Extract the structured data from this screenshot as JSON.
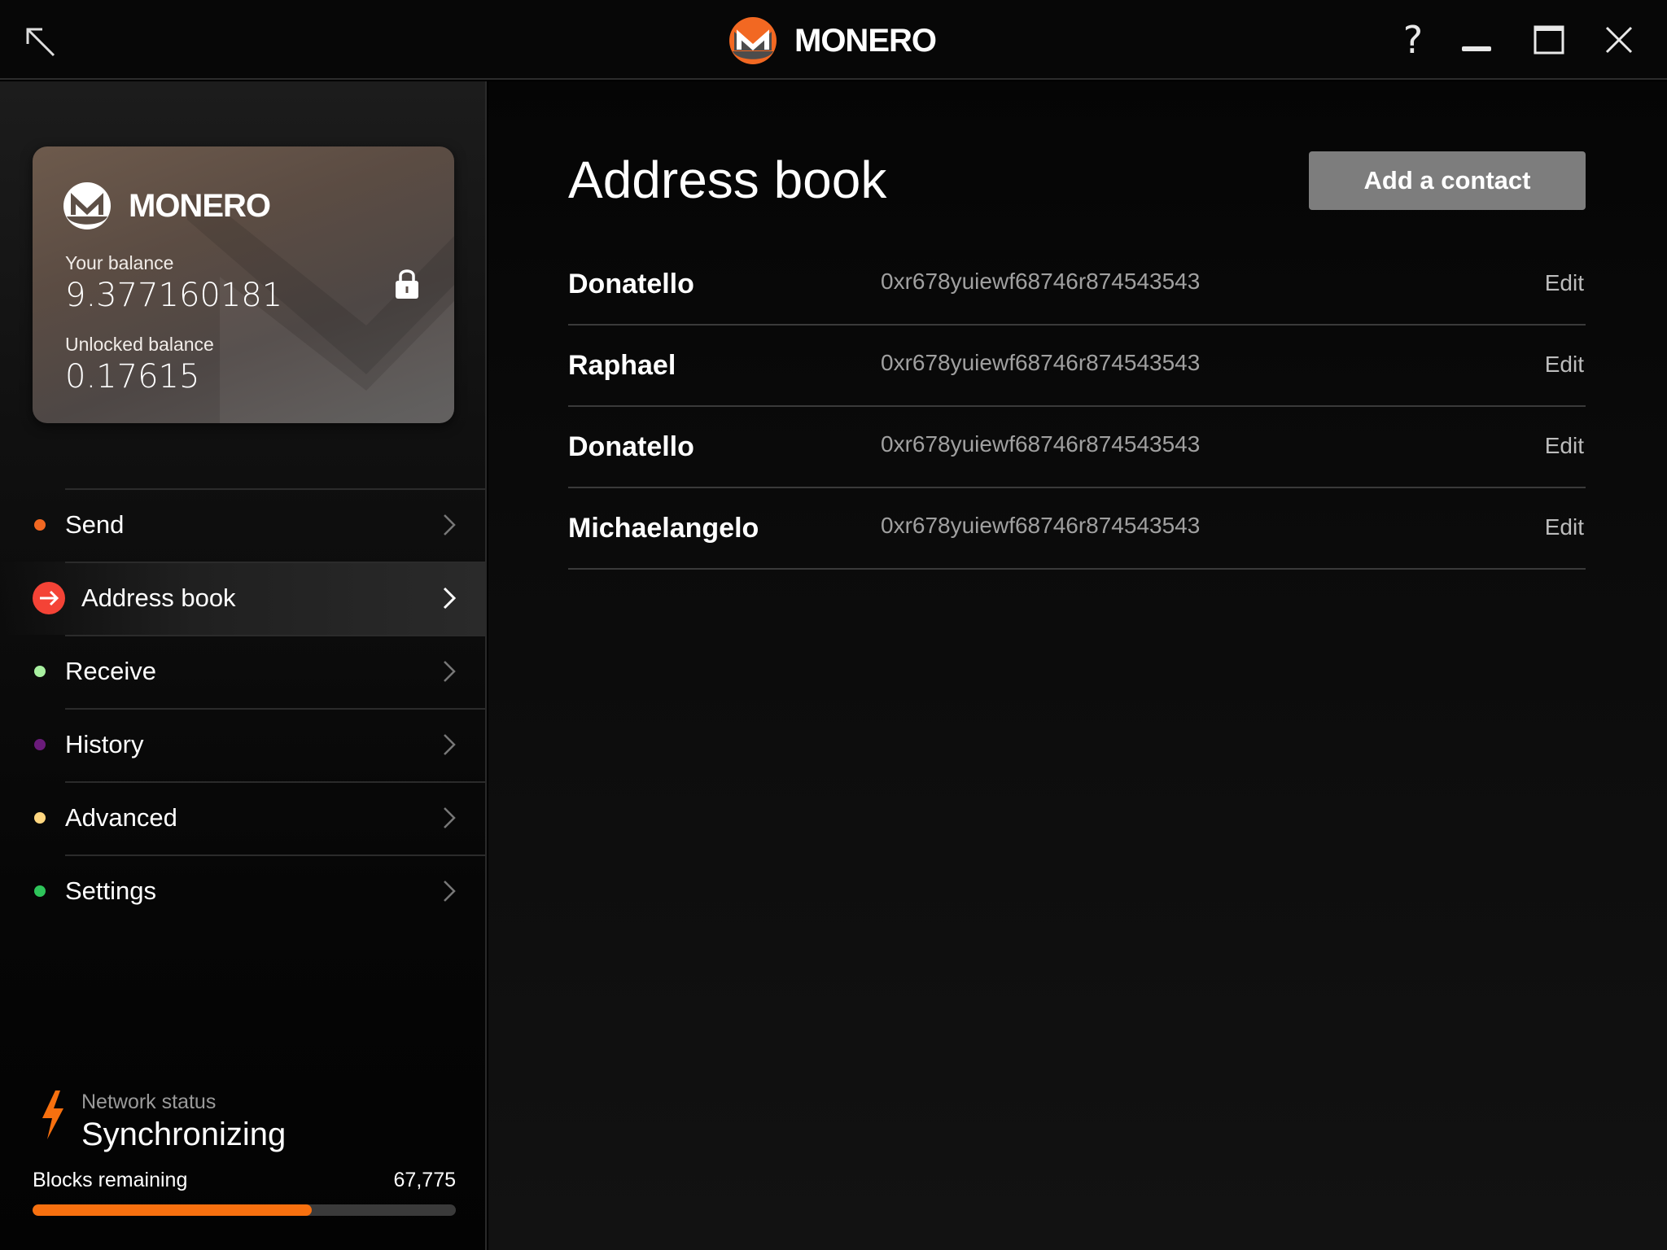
{
  "titlebar": {
    "brand": "MONERO",
    "help_label": "?",
    "icons": [
      "back-arrow-icon",
      "monero-logo-icon",
      "help-icon",
      "minimize-icon",
      "maximize-icon",
      "close-icon"
    ]
  },
  "wallet_card": {
    "brand": "MONERO",
    "balance_label": "Your balance",
    "balance_value": "9.377160181",
    "unlocked_label": "Unlocked balance",
    "unlocked_value": "0.17615",
    "lock_icon": "lock-icon"
  },
  "sidebar": {
    "items": [
      {
        "key": "send",
        "label": "Send",
        "dot_color": "#f26822",
        "active": false
      },
      {
        "key": "address-book",
        "label": "Address book",
        "dot_color": "#f44336",
        "active": true
      },
      {
        "key": "receive",
        "label": "Receive",
        "dot_color": "#a8f0a0",
        "active": false
      },
      {
        "key": "history",
        "label": "History",
        "dot_color": "#6a1b7a",
        "active": false
      },
      {
        "key": "advanced",
        "label": "Advanced",
        "dot_color": "#ffd780",
        "active": false
      },
      {
        "key": "settings",
        "label": "Settings",
        "dot_color": "#2ec45a",
        "active": false
      }
    ]
  },
  "network": {
    "status_label": "Network status",
    "status_value": "Synchronizing",
    "blocks_label": "Blocks remaining",
    "blocks_value": "67,775",
    "progress_fraction": 0.66
  },
  "main": {
    "title": "Address book",
    "add_button": "Add a contact",
    "contacts": [
      {
        "name": "Donatello",
        "address": "0xr678yuiewf68746r874543543",
        "edit": "Edit"
      },
      {
        "name": "Raphael",
        "address": "0xr678yuiewf68746r874543543",
        "edit": "Edit"
      },
      {
        "name": "Donatello",
        "address": "0xr678yuiewf68746r874543543",
        "edit": "Edit"
      },
      {
        "name": "Michaelangelo",
        "address": "0xr678yuiewf68746r874543543",
        "edit": "Edit"
      }
    ]
  },
  "colors": {
    "accent": "#f7700f",
    "active_nav": "#f44336",
    "button_bg": "#7d7d7d"
  }
}
